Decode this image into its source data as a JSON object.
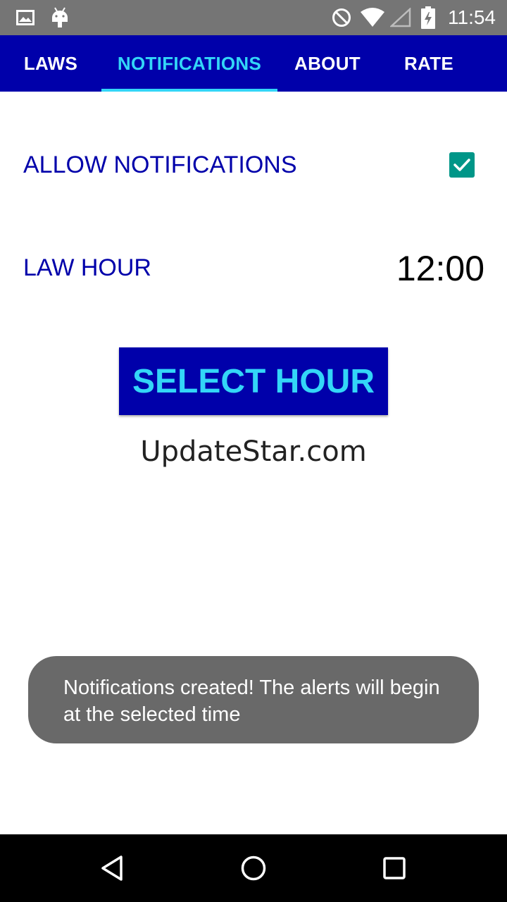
{
  "status_bar": {
    "time": "11:54",
    "left_icons": [
      "image-icon",
      "android-icon"
    ],
    "right_icons": [
      "do-not-disturb-icon",
      "wifi-icon",
      "signal-icon",
      "battery-charging-icon"
    ]
  },
  "tabs": [
    {
      "label": "LAWS",
      "active": false
    },
    {
      "label": "NOTIFICATIONS",
      "active": true
    },
    {
      "label": "ABOUT",
      "active": false
    },
    {
      "label": "RATE",
      "active": false
    }
  ],
  "notifications": {
    "allow_label": "ALLOW NOTIFICATIONS",
    "allow_checked": true,
    "law_hour_label": "LAW HOUR",
    "law_hour_value": "12:00",
    "select_hour_button": "SELECT HOUR",
    "credit": "UpdateStar.com"
  },
  "toast": {
    "message": "Notifications created! The alerts will begin at the selected time"
  },
  "nav_bar": {
    "buttons": [
      "back-icon",
      "home-icon",
      "recents-icon"
    ]
  },
  "colors": {
    "primary": "#0000aa",
    "accent": "#33d6f7",
    "checkbox": "#009688",
    "status_bar": "#757575",
    "toast": "#696969"
  }
}
